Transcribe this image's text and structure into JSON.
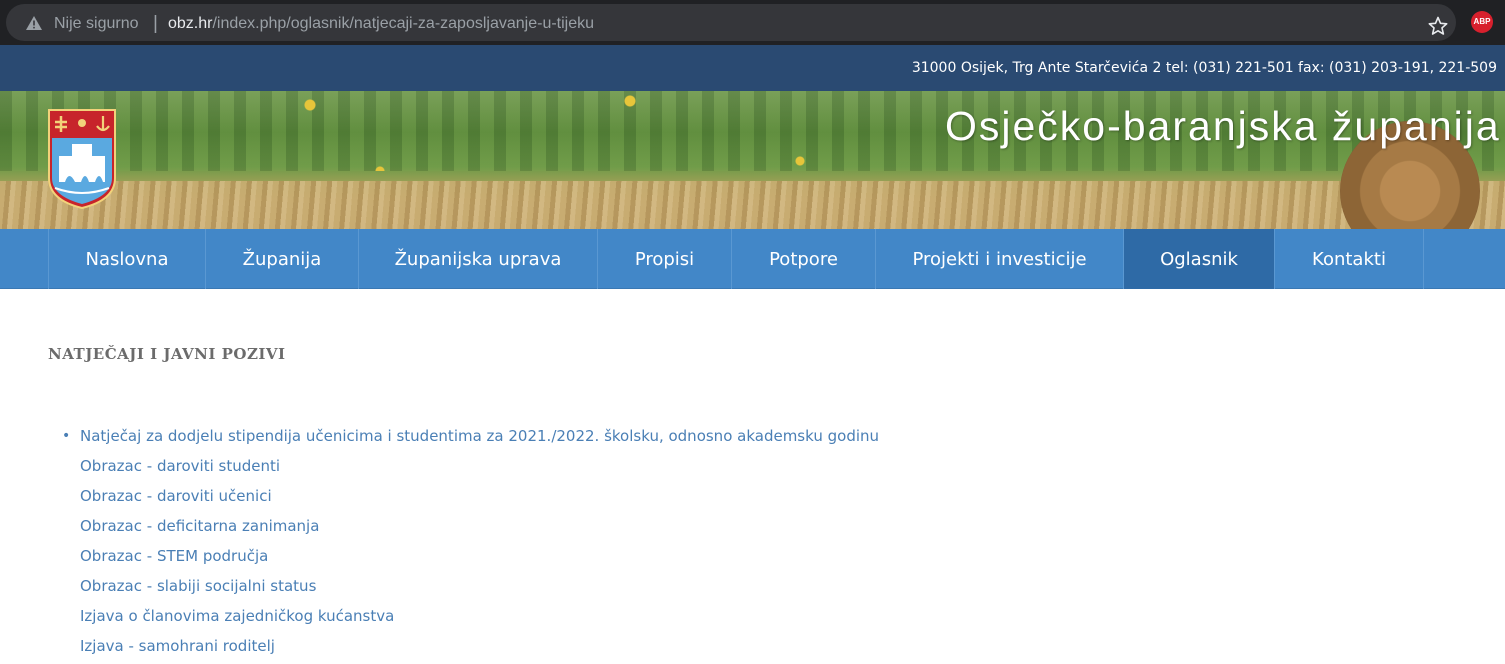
{
  "browser": {
    "security_label": "Nije sigurno",
    "separator": "|",
    "url_domain": "obz.hr",
    "url_path": "/index.php/oglasnik/natjecaji-za-zaposljavanje-u-tijeku",
    "extension_label": "ABP",
    "icons": [
      "warning-icon",
      "star-icon",
      "adblock-icon"
    ]
  },
  "header": {
    "contact_info": "31000 Osijek, Trg Ante Starčevića 2 tel: (031) 221-501 fax: (031) 203-191, 221-509",
    "county_name": "Osječko-baranjska županija"
  },
  "nav": {
    "items": [
      {
        "label": "Naslovna",
        "active": false
      },
      {
        "label": "Županija",
        "active": false
      },
      {
        "label": "Županijska uprava",
        "active": false
      },
      {
        "label": "Propisi",
        "active": false
      },
      {
        "label": "Potpore",
        "active": false
      },
      {
        "label": "Projekti i investicije",
        "active": false
      },
      {
        "label": "Oglasnik",
        "active": true
      },
      {
        "label": "Kontakti",
        "active": false
      }
    ]
  },
  "main": {
    "section_title": "NATJEČAJI I JAVNI POZIVI",
    "links": [
      "Natječaj za dodjelu stipendija učenicima i studentima za 2021./2022. školsku, odnosno akademsku godinu",
      "Obrazac - daroviti studenti",
      "Obrazac - daroviti učenici",
      "Obrazac - deficitarna zanimanja",
      "Obrazac - STEM područja",
      "Obrazac - slabiji socijalni status",
      "Izjava o članovima zajedničkog kućanstva",
      "Izjava - samohrani roditelj"
    ]
  },
  "colors": {
    "nav_bg": "#4287c8",
    "nav_active": "#2e6aa6",
    "info_bar": "#2a4a72",
    "link": "#4a7fb5"
  }
}
